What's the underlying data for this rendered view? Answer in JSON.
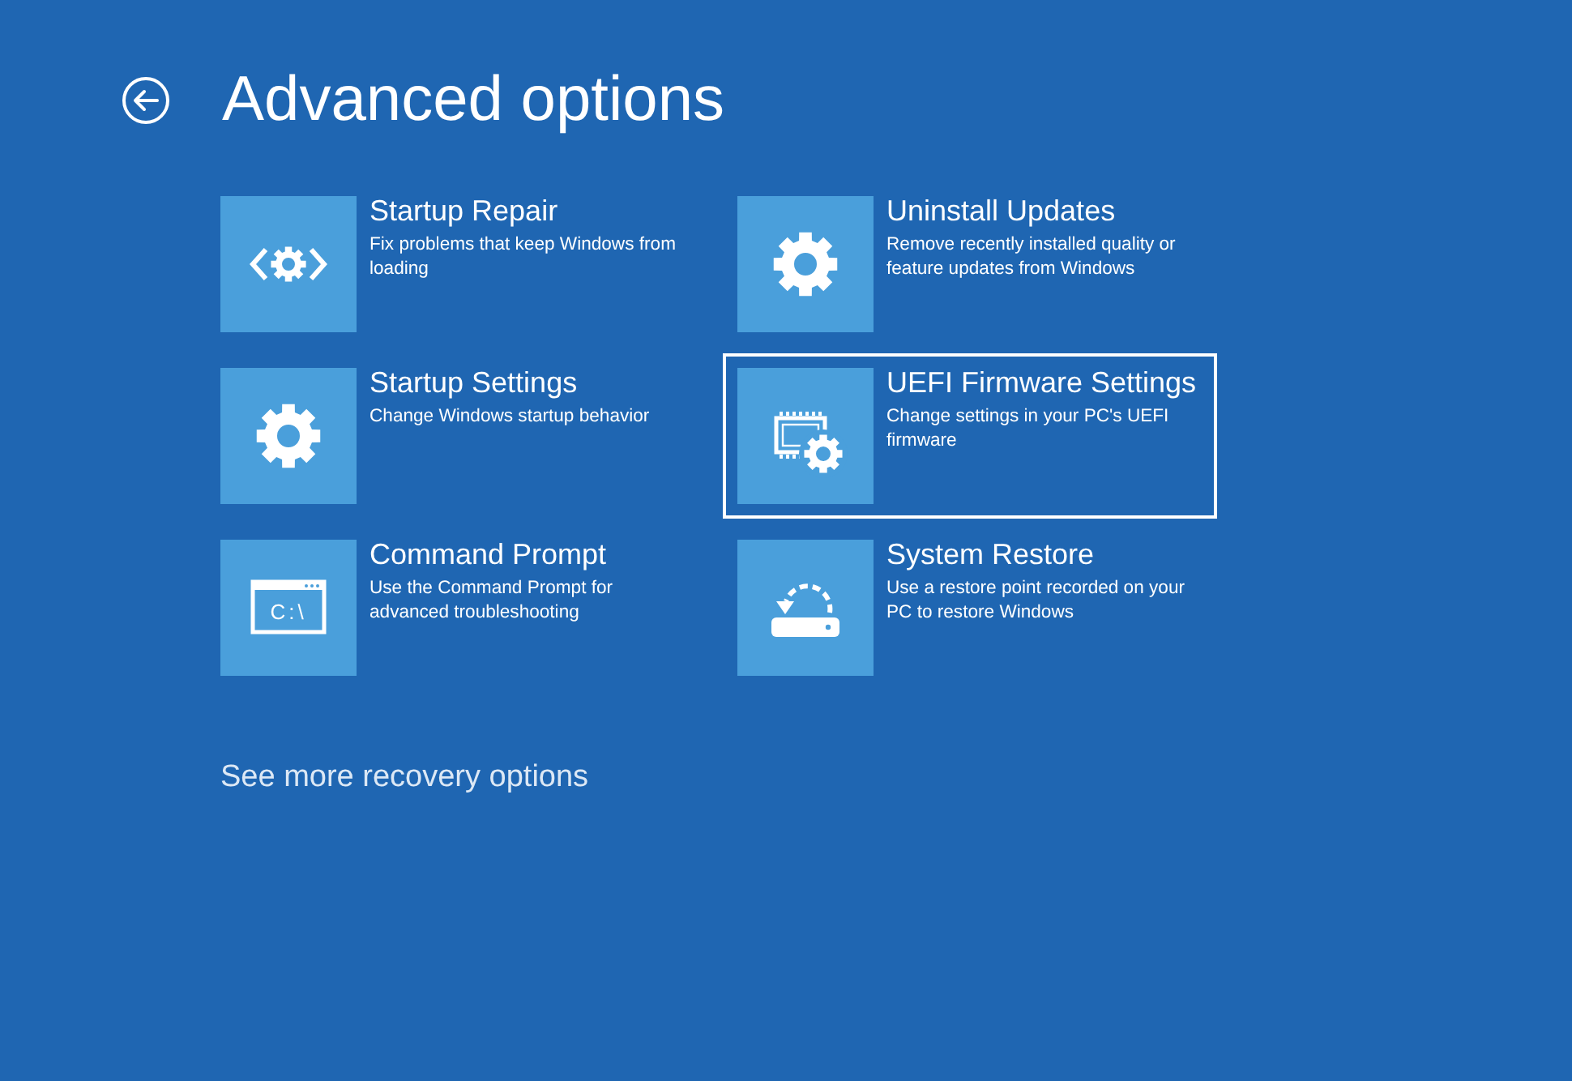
{
  "header": {
    "title": "Advanced options"
  },
  "options": [
    {
      "kind": "repair",
      "title": "Startup Repair",
      "description": "Fix problems that keep Windows from loading",
      "selected": false
    },
    {
      "kind": "gear",
      "title": "Uninstall Updates",
      "description": "Remove recently installed quality or feature updates from Windows",
      "selected": false
    },
    {
      "kind": "gear",
      "title": "Startup Settings",
      "description": "Change Windows startup behavior",
      "selected": false
    },
    {
      "kind": "firmware",
      "title": "UEFI Firmware Settings",
      "description": "Change settings in your PC's UEFI firmware",
      "selected": true
    },
    {
      "kind": "console",
      "title": "Command Prompt",
      "description": "Use the Command Prompt for advanced troubleshooting",
      "selected": false,
      "icon_text": "C:\\"
    },
    {
      "kind": "restore",
      "title": "System Restore",
      "description": "Use a restore point recorded on your PC to restore Windows",
      "selected": false
    }
  ],
  "more_link": "See more recovery options"
}
